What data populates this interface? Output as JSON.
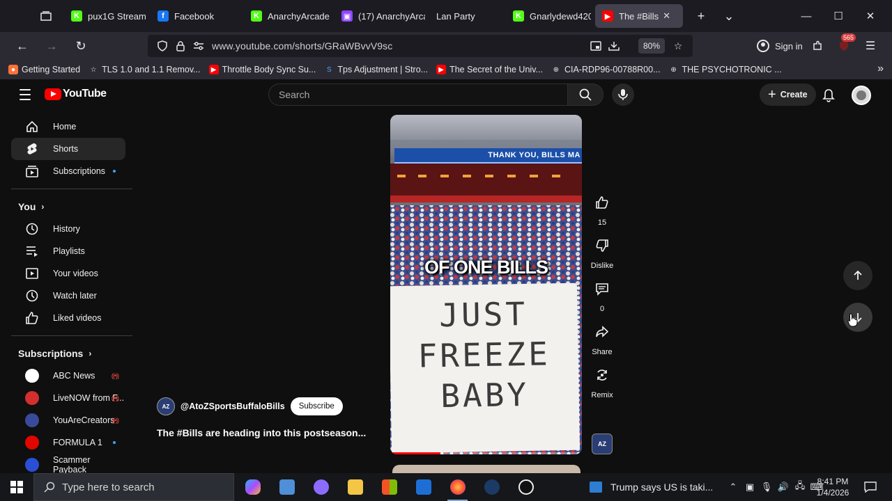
{
  "browser": {
    "tabs": [
      {
        "label": "pux1G Stream - ",
        "fav_color": "#53fc18",
        "fav_glyph": "K"
      },
      {
        "label": "Facebook",
        "fav_color": "#1877f2",
        "fav_glyph": "f"
      },
      {
        "label": "AnarchyArcade ",
        "fav_color": "#53fc18",
        "fav_glyph": "K"
      },
      {
        "label": "(17) AnarchyArca",
        "fav_color": "#9146ff",
        "fav_glyph": "▣"
      },
      {
        "label": "Lan Party",
        "fav_color": "",
        "fav_glyph": ""
      },
      {
        "label": "Gnarlydewd420 ",
        "fav_color": "#53fc18",
        "fav_glyph": "K"
      },
      {
        "label": "The #Bills",
        "fav_color": "#ff0000",
        "fav_glyph": "▶"
      }
    ],
    "url": "www.youtube.com/shorts/GRaWBvvV9sc",
    "zoom": "80%",
    "sign_in": "Sign in",
    "ext_badge": "565",
    "bookmarks": [
      {
        "label": "Getting Started",
        "color": "#ff7139",
        "glyph": "●"
      },
      {
        "label": "TLS 1.0 and 1.1 Remov...",
        "color": "",
        "glyph": "☆"
      },
      {
        "label": "Throttle Body Sync Su...",
        "color": "#ff0000",
        "glyph": "▶"
      },
      {
        "label": "Tps Adjustment | Stro...",
        "color": "",
        "glyph": "S"
      },
      {
        "label": "The Secret of the Univ...",
        "color": "#ff0000",
        "glyph": "▶"
      },
      {
        "label": "CIA-RDP96-00788R00...",
        "color": "",
        "glyph": "⊕"
      },
      {
        "label": "THE PSYCHOTRONIC ...",
        "color": "",
        "glyph": "⊕"
      }
    ]
  },
  "youtube": {
    "logo": "YouTube",
    "search_placeholder": "Search",
    "create": "Create",
    "guide": {
      "main": [
        {
          "label": "Home",
          "icon": "home-icon"
        },
        {
          "label": "Shorts",
          "icon": "shorts-icon",
          "active": true
        },
        {
          "label": "Subscriptions",
          "icon": "subscriptions-icon",
          "dot": true
        }
      ],
      "you_header": "You",
      "you": [
        {
          "label": "History",
          "icon": "history-icon"
        },
        {
          "label": "Playlists",
          "icon": "playlists-icon"
        },
        {
          "label": "Your videos",
          "icon": "your-videos-icon"
        },
        {
          "label": "Watch later",
          "icon": "watch-later-icon"
        },
        {
          "label": "Liked videos",
          "icon": "liked-videos-icon"
        }
      ],
      "subs_header": "Subscriptions",
      "subscriptions": [
        {
          "label": "ABC News",
          "avatar": "#ffffff",
          "badge": "live"
        },
        {
          "label": "LiveNOW from F...",
          "avatar": "#d32f2f",
          "badge": "live"
        },
        {
          "label": "YouAreCreators",
          "avatar": "#3a4a9a",
          "badge": "live"
        },
        {
          "label": "FORMULA 1",
          "avatar": "#e10600",
          "badge": "dot"
        },
        {
          "label": "Scammer Payback",
          "avatar": "#2a4fd6",
          "badge": ""
        }
      ]
    },
    "short": {
      "sticker_text": "THANK YOU, BILLS MA",
      "overlay_text": "OF ONE BILLS",
      "sign_text": "JUST\nFREEZE\nBABY",
      "likes": "15",
      "dislike": "Dislike",
      "comments": "0",
      "share": "Share",
      "remix": "Remix",
      "channel_handle": "@AtoZSportsBuffaloBills",
      "channel_initials": "AZ",
      "subscribe": "Subscribe",
      "title": "The #Bills are heading into this postseason..."
    }
  },
  "taskbar": {
    "search_placeholder": "Type here to search",
    "news": "Trump says US is taki...",
    "time": "8:41 PM",
    "date": "1/4/2026"
  }
}
